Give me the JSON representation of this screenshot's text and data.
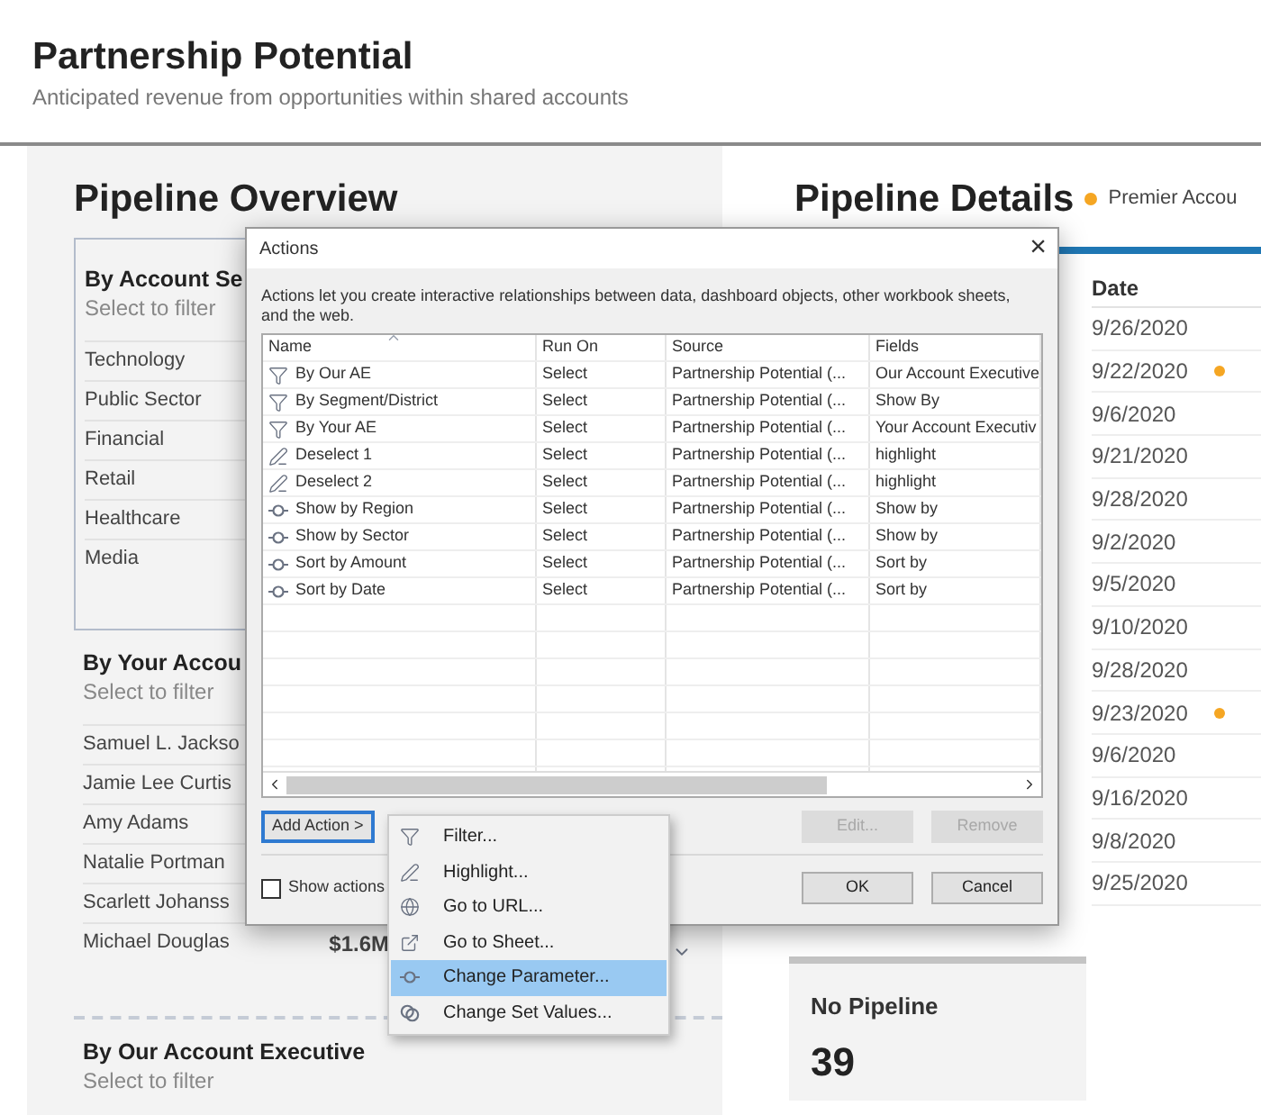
{
  "header": {
    "title": "Partnership Potential",
    "subtitle": "Anticipated revenue from opportunities within shared accounts"
  },
  "overview": {
    "title": "Pipeline Overview",
    "sections": [
      {
        "title": "By Account Se",
        "hint": "Select to filter",
        "items": [
          {
            "label": "Technology"
          },
          {
            "label": "Public Sector"
          },
          {
            "label": "Financial"
          },
          {
            "label": "Retail"
          },
          {
            "label": "Healthcare"
          },
          {
            "label": "Media"
          }
        ]
      },
      {
        "title": "By Your Accou",
        "hint": "Select to filter",
        "items": [
          {
            "label": "Samuel L. Jackso"
          },
          {
            "label": "Jamie Lee Curtis"
          },
          {
            "label": "Amy Adams"
          },
          {
            "label": "Natalie Portman"
          },
          {
            "label": "Scarlett Johanss"
          },
          {
            "label": "Michael Douglas",
            "value": "$1.6M"
          }
        ]
      },
      {
        "title": "By Our Account Executive",
        "hint": "Select to filter"
      }
    ]
  },
  "details": {
    "title": "Pipeline Details",
    "legend": {
      "label": "Premier Accou",
      "color": "#f5a623"
    },
    "column": "Date",
    "rows": [
      {
        "date": "9/26/2020",
        "premier": false
      },
      {
        "date": "9/22/2020",
        "premier": true
      },
      {
        "date": "9/6/2020",
        "premier": false
      },
      {
        "date": "9/21/2020",
        "premier": false
      },
      {
        "date": "9/28/2020",
        "premier": false
      },
      {
        "date": "9/2/2020",
        "premier": false
      },
      {
        "date": "9/5/2020",
        "premier": false
      },
      {
        "date": "9/10/2020",
        "premier": false
      },
      {
        "date": "9/28/2020",
        "premier": false
      },
      {
        "date": "9/23/2020",
        "premier": true
      },
      {
        "date": "9/6/2020",
        "premier": false
      },
      {
        "date": "9/16/2020",
        "premier": false
      },
      {
        "date": "9/8/2020",
        "premier": false
      },
      {
        "date": "9/25/2020",
        "premier": false
      }
    ]
  },
  "no_pipeline": {
    "label": "No Pipeline",
    "count": "39"
  },
  "dialog": {
    "title": "Actions",
    "close": "×",
    "description": "Actions let you create interactive relationships between data, dashboard objects, other workbook sheets, and the web.",
    "columns": [
      "Name",
      "Run On",
      "Source",
      "Fields"
    ],
    "rows": [
      {
        "kind": "filter",
        "name": "By Our AE",
        "run_on": "Select",
        "source": "Partnership Potential (...",
        "fields": "Our Account Executive"
      },
      {
        "kind": "filter",
        "name": "By Segment/District",
        "run_on": "Select",
        "source": "Partnership Potential (...",
        "fields": "Show By"
      },
      {
        "kind": "filter",
        "name": "By Your AE",
        "run_on": "Select",
        "source": "Partnership Potential (...",
        "fields": "Your Account Executiv"
      },
      {
        "kind": "highlight",
        "name": "Deselect 1",
        "run_on": "Select",
        "source": "Partnership Potential (...",
        "fields": "highlight"
      },
      {
        "kind": "highlight",
        "name": "Deselect 2",
        "run_on": "Select",
        "source": "Partnership Potential (...",
        "fields": "highlight"
      },
      {
        "kind": "parameter",
        "name": "Show by Region",
        "run_on": "Select",
        "source": "Partnership Potential (...",
        "fields": "Show by"
      },
      {
        "kind": "parameter",
        "name": "Show by Sector",
        "run_on": "Select",
        "source": "Partnership Potential (...",
        "fields": "Show by"
      },
      {
        "kind": "parameter",
        "name": "Sort by Amount",
        "run_on": "Select",
        "source": "Partnership Potential (...",
        "fields": "Sort by"
      },
      {
        "kind": "parameter",
        "name": "Sort by Date",
        "run_on": "Select",
        "source": "Partnership Potential (...",
        "fields": "Sort by"
      }
    ],
    "add_action": "Add Action >",
    "buttons": [
      {
        "label": "Edit...",
        "disabled": true
      },
      {
        "label": "Remove",
        "disabled": true
      }
    ],
    "show_actions": {
      "label": "Show actions",
      "checked": false
    },
    "footer": [
      {
        "label": "OK",
        "disabled": false
      },
      {
        "label": "Cancel",
        "disabled": false
      }
    ]
  },
  "menu": [
    {
      "kind": "filter",
      "label": "Filter...",
      "selected": false
    },
    {
      "kind": "highlight",
      "label": "Highlight...",
      "selected": false
    },
    {
      "kind": "url",
      "label": "Go to URL...",
      "selected": false
    },
    {
      "kind": "sheet",
      "label": "Go to Sheet...",
      "selected": false
    },
    {
      "kind": "parameter",
      "label": "Change Parameter...",
      "selected": true
    },
    {
      "kind": "set",
      "label": "Change Set Values...",
      "selected": false
    }
  ]
}
